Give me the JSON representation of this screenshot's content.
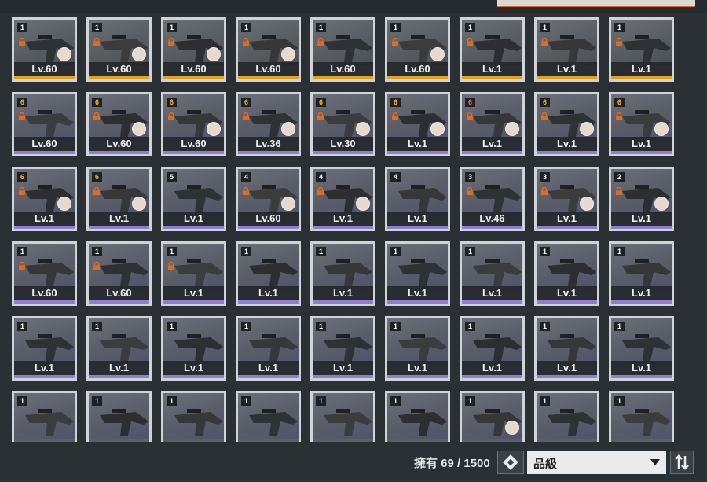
{
  "inventory": {
    "count_text": "擁有 69 / 1500",
    "sort_select": {
      "value": "品級"
    },
    "cards": [
      {
        "level": "Lv.60",
        "badge": "1",
        "badge_color": "white",
        "rarity": "gold",
        "locked": true,
        "avatar": true
      },
      {
        "level": "Lv.60",
        "badge": "1",
        "badge_color": "white",
        "rarity": "gold",
        "locked": true,
        "avatar": true
      },
      {
        "level": "Lv.60",
        "badge": "1",
        "badge_color": "white",
        "rarity": "gold",
        "locked": true,
        "avatar": true
      },
      {
        "level": "Lv.60",
        "badge": "1",
        "badge_color": "white",
        "rarity": "gold",
        "locked": true,
        "avatar": true
      },
      {
        "level": "Lv.60",
        "badge": "1",
        "badge_color": "white",
        "rarity": "gold",
        "locked": true,
        "avatar": false
      },
      {
        "level": "Lv.60",
        "badge": "1",
        "badge_color": "white",
        "rarity": "gold",
        "locked": true,
        "avatar": true
      },
      {
        "level": "Lv.1",
        "badge": "1",
        "badge_color": "white",
        "rarity": "gold",
        "locked": true,
        "avatar": false
      },
      {
        "level": "Lv.1",
        "badge": "1",
        "badge_color": "white",
        "rarity": "gold",
        "locked": true,
        "avatar": false
      },
      {
        "level": "Lv.1",
        "badge": "1",
        "badge_color": "white",
        "rarity": "gold",
        "locked": true,
        "avatar": false
      },
      {
        "level": "Lv.60",
        "badge": "6",
        "badge_color": "gold",
        "rarity": "purple",
        "locked": true,
        "avatar": false
      },
      {
        "level": "Lv.60",
        "badge": "6",
        "badge_color": "gold",
        "rarity": "purple",
        "locked": true,
        "avatar": true
      },
      {
        "level": "Lv.60",
        "badge": "6",
        "badge_color": "gold",
        "rarity": "purple",
        "locked": true,
        "avatar": true
      },
      {
        "level": "Lv.36",
        "badge": "6",
        "badge_color": "gold",
        "rarity": "purple",
        "locked": true,
        "avatar": true
      },
      {
        "level": "Lv.30",
        "badge": "6",
        "badge_color": "gold",
        "rarity": "purple",
        "locked": true,
        "avatar": true
      },
      {
        "level": "Lv.1",
        "badge": "6",
        "badge_color": "gold",
        "rarity": "purple",
        "locked": true,
        "avatar": true
      },
      {
        "level": "Lv.1",
        "badge": "6",
        "badge_color": "red",
        "rarity": "purple",
        "locked": true,
        "avatar": true
      },
      {
        "level": "Lv.1",
        "badge": "6",
        "badge_color": "gold",
        "rarity": "purple",
        "locked": true,
        "avatar": true
      },
      {
        "level": "Lv.1",
        "badge": "6",
        "badge_color": "gold",
        "rarity": "purple",
        "locked": true,
        "avatar": true
      },
      {
        "level": "Lv.1",
        "badge": "6",
        "badge_color": "gold",
        "rarity": "purple",
        "locked": true,
        "avatar": true
      },
      {
        "level": "Lv.1",
        "badge": "6",
        "badge_color": "gold",
        "rarity": "purple",
        "locked": true,
        "avatar": true
      },
      {
        "level": "Lv.1",
        "badge": "5",
        "badge_color": "white",
        "rarity": "purple",
        "locked": false,
        "avatar": false
      },
      {
        "level": "Lv.60",
        "badge": "4",
        "badge_color": "white",
        "rarity": "purple",
        "locked": true,
        "avatar": true
      },
      {
        "level": "Lv.1",
        "badge": "4",
        "badge_color": "white",
        "rarity": "purple",
        "locked": true,
        "avatar": true
      },
      {
        "level": "Lv.1",
        "badge": "4",
        "badge_color": "white",
        "rarity": "purple",
        "locked": false,
        "avatar": false
      },
      {
        "level": "Lv.46",
        "badge": "3",
        "badge_color": "white",
        "rarity": "purple",
        "locked": true,
        "avatar": false
      },
      {
        "level": "Lv.1",
        "badge": "3",
        "badge_color": "white",
        "rarity": "purple",
        "locked": true,
        "avatar": true
      },
      {
        "level": "Lv.1",
        "badge": "2",
        "badge_color": "white",
        "rarity": "purple",
        "locked": true,
        "avatar": true
      },
      {
        "level": "Lv.60",
        "badge": "1",
        "badge_color": "white",
        "rarity": "purple",
        "locked": true,
        "avatar": false
      },
      {
        "level": "Lv.60",
        "badge": "1",
        "badge_color": "white",
        "rarity": "purple",
        "locked": true,
        "avatar": false
      },
      {
        "level": "Lv.1",
        "badge": "1",
        "badge_color": "white",
        "rarity": "purple",
        "locked": true,
        "avatar": false
      },
      {
        "level": "Lv.1",
        "badge": "1",
        "badge_color": "white",
        "rarity": "purple",
        "locked": false,
        "avatar": false
      },
      {
        "level": "Lv.1",
        "badge": "1",
        "badge_color": "white",
        "rarity": "purple",
        "locked": false,
        "avatar": false
      },
      {
        "level": "Lv.1",
        "badge": "1",
        "badge_color": "white",
        "rarity": "purple",
        "locked": false,
        "avatar": false
      },
      {
        "level": "Lv.1",
        "badge": "1",
        "badge_color": "white",
        "rarity": "purple",
        "locked": false,
        "avatar": false
      },
      {
        "level": "Lv.1",
        "badge": "1",
        "badge_color": "white",
        "rarity": "purple",
        "locked": false,
        "avatar": false
      },
      {
        "level": "Lv.1",
        "badge": "1",
        "badge_color": "white",
        "rarity": "purple",
        "locked": false,
        "avatar": false
      },
      {
        "level": "Lv.1",
        "badge": "1",
        "badge_color": "white",
        "rarity": "purple",
        "locked": false,
        "avatar": false
      },
      {
        "level": "Lv.1",
        "badge": "1",
        "badge_color": "white",
        "rarity": "purple",
        "locked": false,
        "avatar": false
      },
      {
        "level": "Lv.1",
        "badge": "1",
        "badge_color": "white",
        "rarity": "purple",
        "locked": false,
        "avatar": false
      },
      {
        "level": "Lv.1",
        "badge": "1",
        "badge_color": "white",
        "rarity": "purple",
        "locked": false,
        "avatar": false
      },
      {
        "level": "Lv.1",
        "badge": "1",
        "badge_color": "white",
        "rarity": "purple",
        "locked": false,
        "avatar": false
      },
      {
        "level": "Lv.1",
        "badge": "1",
        "badge_color": "white",
        "rarity": "purple",
        "locked": false,
        "avatar": false
      },
      {
        "level": "Lv.1",
        "badge": "1",
        "badge_color": "white",
        "rarity": "purple",
        "locked": false,
        "avatar": false
      },
      {
        "level": "Lv.1",
        "badge": "1",
        "badge_color": "white",
        "rarity": "purple",
        "locked": false,
        "avatar": false
      },
      {
        "level": "Lv.1",
        "badge": "1",
        "badge_color": "white",
        "rarity": "purple",
        "locked": false,
        "avatar": false
      },
      {
        "level": "",
        "badge": "1",
        "badge_color": "white",
        "rarity": "purple",
        "locked": false,
        "avatar": false
      },
      {
        "level": "",
        "badge": "1",
        "badge_color": "white",
        "rarity": "purple",
        "locked": false,
        "avatar": false
      },
      {
        "level": "",
        "badge": "1",
        "badge_color": "white",
        "rarity": "purple",
        "locked": false,
        "avatar": false
      },
      {
        "level": "",
        "badge": "1",
        "badge_color": "white",
        "rarity": "purple",
        "locked": false,
        "avatar": false
      },
      {
        "level": "",
        "badge": "1",
        "badge_color": "white",
        "rarity": "purple",
        "locked": false,
        "avatar": false
      },
      {
        "level": "",
        "badge": "1",
        "badge_color": "white",
        "rarity": "purple",
        "locked": false,
        "avatar": false
      },
      {
        "level": "",
        "badge": "1",
        "badge_color": "white",
        "rarity": "purple",
        "locked": false,
        "avatar": true
      },
      {
        "level": "",
        "badge": "1",
        "badge_color": "white",
        "rarity": "purple",
        "locked": false,
        "avatar": false
      },
      {
        "level": "",
        "badge": "1",
        "badge_color": "white",
        "rarity": "purple",
        "locked": false,
        "avatar": false
      }
    ]
  },
  "icons": {
    "lock": "padlock-icon",
    "filter": "diamond-filter-icon",
    "sort": "sort-toggle-icon",
    "dropdown": "chevron-down-icon"
  },
  "colors": {
    "rarity_gold": "#e2a21b",
    "rarity_purple": "#8f7fd0",
    "lock_orange": "#e56a1e",
    "accent_tab": "#e0641f"
  }
}
